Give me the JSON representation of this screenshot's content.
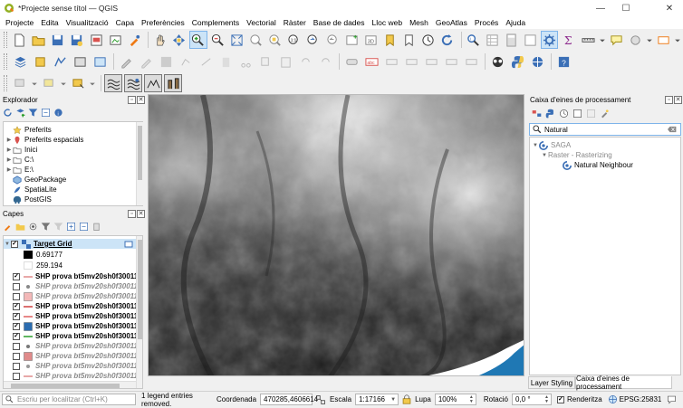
{
  "window": {
    "title": "*Projecte sense títol — QGIS"
  },
  "menu": [
    "Projecte",
    "Edita",
    "Visualització",
    "Capa",
    "Preferències",
    "Complements",
    "Vectorial",
    "Ràster",
    "Base de dades",
    "Lloc web",
    "Mesh",
    "GeoAtlas",
    "Procés",
    "Ajuda"
  ],
  "browser": {
    "title": "Explorador",
    "items": [
      {
        "label": "Preferits",
        "icon": "star-icon"
      },
      {
        "label": "Preferits espacials",
        "icon": "spatial-bookmark-icon"
      },
      {
        "label": "Inici",
        "icon": "folder-icon"
      },
      {
        "label": "C:\\",
        "icon": "folder-icon"
      },
      {
        "label": "E:\\",
        "icon": "folder-icon"
      },
      {
        "label": "GeoPackage",
        "icon": "geopackage-icon"
      },
      {
        "label": "SpatiaLite",
        "icon": "spatialite-icon"
      },
      {
        "label": "PostGIS",
        "icon": "postgis-icon"
      }
    ]
  },
  "layers": {
    "title": "Capes",
    "target_grid": "Target Grid",
    "legend_low": "0.69177",
    "legend_high": "259.194",
    "items": [
      {
        "label": "SHP prova bt5mv20sh0f30011",
        "checked": true,
        "color": "#e08a8a",
        "style": "line"
      },
      {
        "label": "SHP prova bt5mv20sh0f30011",
        "checked": false,
        "color": "#888888",
        "style": "point"
      },
      {
        "label": "SHP prova bt5mv20sh0f30011",
        "checked": false,
        "color": "#f3b8b8",
        "style": "square"
      },
      {
        "label": "SHP prova bt5mv20sh0f30011",
        "checked": true,
        "color": "#d04040",
        "style": "line"
      },
      {
        "label": "SHP prova bt5mv20sh0f30011",
        "checked": true,
        "color": "#e06060",
        "style": "line"
      },
      {
        "label": "SHP prova bt5mv20sh0f30011",
        "checked": true,
        "color": "#2b6cb0",
        "style": "square"
      },
      {
        "label": "SHP prova bt5mv20sh0f30011",
        "checked": true,
        "color": "#2a9d2a",
        "style": "line"
      },
      {
        "label": "SHP prova bt5mv20sh0f30011",
        "checked": false,
        "color": "#777777",
        "style": "point"
      },
      {
        "label": "SHP prova bt5mv20sh0f30011",
        "checked": false,
        "color": "#e08a8a",
        "style": "square"
      },
      {
        "label": "SHP prova bt5mv20sh0f30011",
        "checked": false,
        "color": "#999999",
        "style": "point"
      },
      {
        "label": "SHP prova bt5mv20sh0f30011",
        "checked": false,
        "color": "#e08a8a",
        "style": "line"
      }
    ]
  },
  "processing": {
    "title": "Caixa d'eines de processament",
    "search_value": "Natural",
    "group": "SAGA",
    "subgroup": "Raster - Rasterizing",
    "algorithm": "Natural Neighbour"
  },
  "tabs": {
    "layer_styling": "Layer Styling",
    "processing": "Caixa d'eines de processament"
  },
  "status": {
    "search_placeholder": "Escriu per localitzar (Ctrl+K)",
    "message": "1 legend entries removed.",
    "coord_label": "Coordenada",
    "coord_value": "470285,4606614",
    "scale_label": "Escala",
    "scale_value": "1:17166",
    "magnifier_label": "Lupa",
    "magnifier_value": "100%",
    "rotation_label": "Rotació",
    "rotation_value": "0,0 °",
    "render_label": "Renderitza",
    "crs": "EPSG:25831"
  },
  "colors": {
    "accent": "#2b6cb0",
    "selection": "#cce4f7",
    "water": "#1f78b4"
  }
}
